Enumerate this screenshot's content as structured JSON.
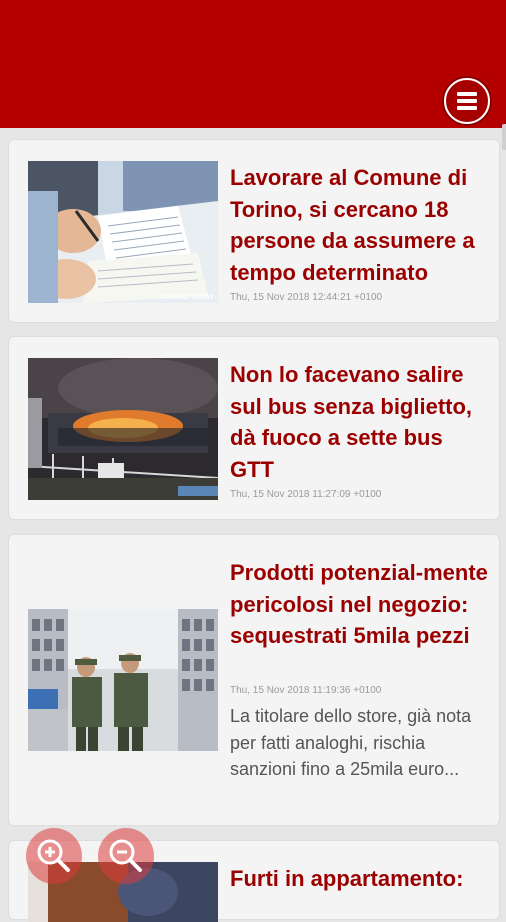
{
  "header": {
    "menu_icon": "hamburger-menu-icon",
    "brand_color": "#b50000"
  },
  "articles": [
    {
      "title": "Lavorare al Comune di Torino, si cercano 18 persone da assumere a tempo determinato",
      "date": "Thu, 15 Nov 2018 12:44:21 +0100",
      "image_watermark": "TORINO TODAY"
    },
    {
      "title": "Non lo facevano salire sul bus senza biglietto, dà fuoco a sette bus GTT",
      "date": "Thu, 15 Nov 2018 11:27:09 +0100"
    },
    {
      "title": "Prodotti potenzial-mente pericolosi nel negozio: sequestrati 5mila pezzi",
      "date": "Thu, 15 Nov 2018 11:19:36 +0100",
      "summary": "La titolare dello store, già nota per fatti analoghi, rischia sanzioni fino a 25mila euro..."
    },
    {
      "title": "Furti in appartamento:"
    }
  ],
  "zoom": {
    "zoom_in_icon": "zoom-in-icon",
    "zoom_out_icon": "zoom-out-icon"
  },
  "colors": {
    "title": "#9b0000",
    "card_bg": "#f4f4f4",
    "page_bg": "#e6e6e6"
  }
}
